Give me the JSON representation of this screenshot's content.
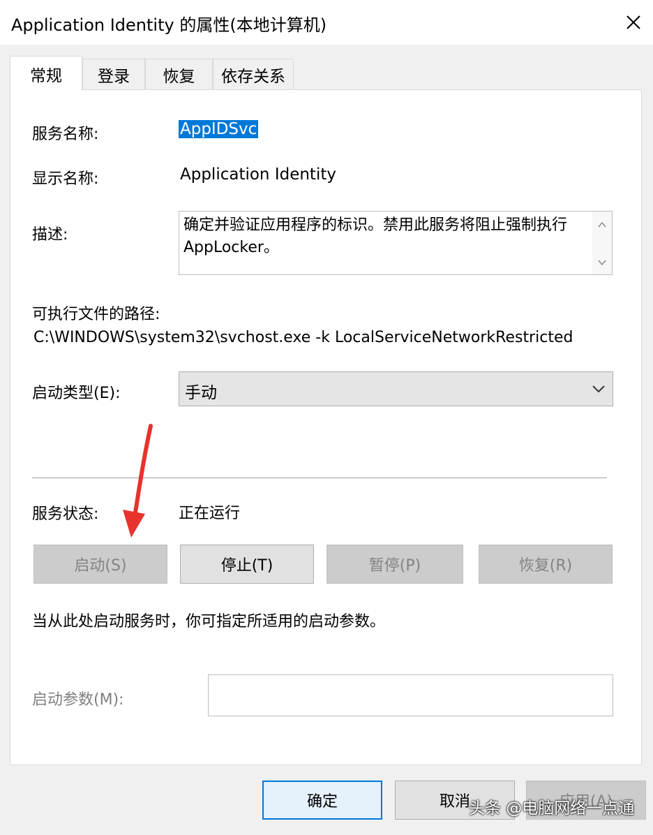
{
  "window": {
    "title": "Application Identity 的属性(本地计算机)"
  },
  "tabs": [
    "常规",
    "登录",
    "恢复",
    "依存关系"
  ],
  "general": {
    "service_name_label": "服务名称:",
    "service_name": "AppIDSvc",
    "display_name_label": "显示名称:",
    "display_name": "Application Identity",
    "description_label": "描述:",
    "description": "确定并验证应用程序的标识。禁用此服务将阻止强制执行 AppLocker。",
    "exe_path_label": "可执行文件的路径:",
    "exe_path": "C:\\WINDOWS\\system32\\svchost.exe -k LocalServiceNetworkRestricted",
    "startup_type_label": "启动类型(E):",
    "startup_type": "手动",
    "status_label": "服务状态:",
    "status": "正在运行",
    "buttons": {
      "start": "启动(S)",
      "stop": "停止(T)",
      "pause": "暂停(P)",
      "resume": "恢复(R)"
    },
    "hint": "当从此处启动服务时，你可指定所适用的启动参数。",
    "start_params_label": "启动参数(M):",
    "start_params_value": ""
  },
  "footer": {
    "ok": "确定",
    "cancel": "取消",
    "apply": "应用(A)"
  },
  "watermark": "头条 @电脑网络一点通",
  "colors": {
    "selection": "#0078d7",
    "annotation_arrow": "#e8322d",
    "ok_border": "#0078d7"
  }
}
